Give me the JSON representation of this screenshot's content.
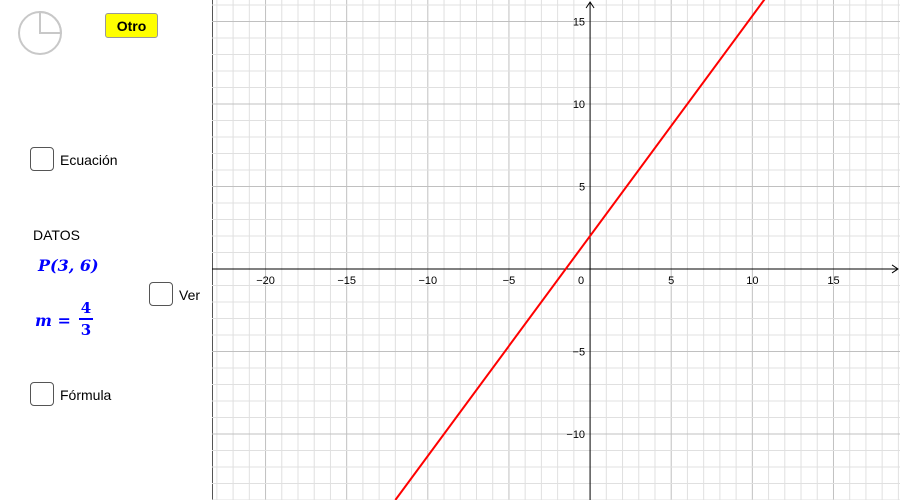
{
  "controls": {
    "reset_icon": "reset-circle-icon",
    "otro_label": "Otro",
    "ecuacion_label": "Ecuación",
    "datos_label": "DATOS",
    "point_text": "P(3, 6)",
    "slope_lhs": "m =",
    "slope_num": "4",
    "slope_den": "3",
    "ver_label": "Ver",
    "formula_label": "Fórmula"
  },
  "colors": {
    "line": "#ff0000",
    "math_text": "#0000ff",
    "button_bg": "#ffff00",
    "grid_major": "#c0c0c0",
    "grid_minor": "#e0e0e0"
  },
  "chart_data": {
    "type": "line",
    "title": "",
    "xlabel": "",
    "ylabel": "",
    "xlim": [
      -23.3,
      19.1
    ],
    "ylim": [
      -14.0,
      16.3
    ],
    "grid": true,
    "x_ticks": [
      -20,
      -15,
      -10,
      -5,
      0,
      5,
      10,
      15
    ],
    "y_ticks": [
      15,
      10,
      5,
      -5,
      -10
    ],
    "tick_labels": {
      "x": [
        "−20",
        "−15",
        "−10",
        "−5",
        "0",
        "5",
        "10",
        "15"
      ],
      "y": [
        "15",
        "10",
        "5",
        "−5",
        "−10"
      ]
    },
    "series": [
      {
        "slope": 1.3333,
        "intercept": 2,
        "x": [
          -12,
          11
        ],
        "y": [
          -14,
          16.67
        ]
      }
    ]
  }
}
